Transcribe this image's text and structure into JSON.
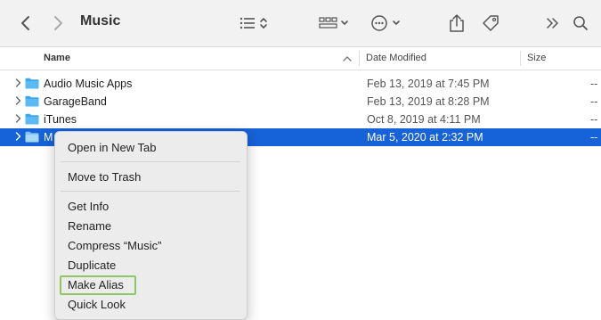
{
  "window": {
    "title": "Music"
  },
  "toolbar": {
    "icons": [
      "back-icon",
      "forward-icon",
      "list-view-icon",
      "grid-view-icon",
      "more-actions-icon",
      "share-icon",
      "tag-icon",
      "overflow-icon",
      "search-icon"
    ]
  },
  "columns": {
    "name": "Name",
    "date_modified": "Date Modified",
    "size": "Size"
  },
  "files": [
    {
      "name": "Audio Music Apps",
      "date": "Feb 13, 2019 at 7:45 PM",
      "size": "--"
    },
    {
      "name": "GarageBand",
      "date": "Feb 13, 2019 at 8:28 PM",
      "size": "--"
    },
    {
      "name": "iTunes",
      "date": "Oct 8, 2019 at 4:11 PM",
      "size": "--"
    },
    {
      "name": "M",
      "date": "Mar 5, 2020 at 2:32 PM",
      "size": "--",
      "selected": true
    }
  ],
  "context_menu": {
    "open_new_tab": "Open in New Tab",
    "move_to_trash": "Move to Trash",
    "get_info": "Get Info",
    "rename": "Rename",
    "compress": "Compress “Music”",
    "duplicate": "Duplicate",
    "make_alias": "Make Alias",
    "quick_look": "Quick Look"
  },
  "colors": {
    "selection": "#1662d8",
    "folder": "#3aa7ec",
    "highlight": "#8fc765"
  }
}
